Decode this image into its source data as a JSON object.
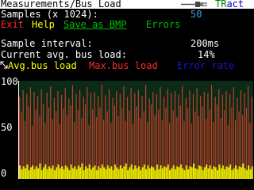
{
  "title_bar": {
    "title": "Measurements/Bus Load",
    "logo_text_a": "TR",
    "logo_text_b": "act"
  },
  "samples": {
    "label": "Samples (x 1024):",
    "value": "50"
  },
  "menu": {
    "exit": "Exit",
    "help": "Help",
    "save_as_bmp": "Save as BMP",
    "errors": "Errors"
  },
  "interval": {
    "label": "Sample interval:",
    "value": "200ms"
  },
  "current_load": {
    "label": "Current avg. bus load:",
    "value": "14%"
  },
  "legend": {
    "avg": "Avg.bus load",
    "max": "Max.bus load",
    "error": "Error rate"
  },
  "colors": {
    "avg": "#e6e600",
    "max": "#c84028",
    "error": "#1818c8",
    "plot_bg": "#0c2a18"
  },
  "chart_data": {
    "type": "bar",
    "ylim": [
      0,
      100
    ],
    "yticks": [
      "100",
      "50",
      "0"
    ],
    "series": [
      {
        "name": "Avg.bus load",
        "values": [
          14,
          10,
          13,
          11,
          15,
          9,
          12,
          14,
          10,
          13,
          11,
          16,
          9,
          12,
          15,
          10,
          13,
          11,
          14,
          9,
          12,
          15,
          11,
          13,
          10,
          14,
          12,
          9,
          15,
          11,
          13,
          10,
          14,
          12,
          16,
          9,
          13,
          11,
          15,
          10,
          12,
          14,
          9,
          13,
          11,
          15,
          12,
          10,
          14,
          11,
          13,
          9,
          15,
          12,
          10,
          14,
          11,
          13,
          16,
          9,
          12,
          15,
          10,
          14,
          11,
          13,
          9,
          12,
          15,
          10,
          14,
          11,
          13,
          12,
          9,
          15,
          10,
          14,
          11,
          13,
          12,
          15,
          9,
          11,
          14,
          10,
          13,
          12,
          15,
          11,
          9,
          14,
          10,
          13,
          12,
          16,
          11,
          10,
          14,
          13,
          9,
          12,
          15,
          11,
          14,
          10,
          13,
          12,
          9,
          15,
          11,
          14,
          10,
          13,
          12,
          15,
          9,
          11,
          14,
          10,
          13,
          12,
          16,
          11,
          9,
          14,
          10,
          13
        ]
      },
      {
        "name": "Max.bus load",
        "values": [
          85,
          70,
          92,
          60,
          88,
          75,
          95,
          55,
          90,
          72,
          86,
          65,
          93,
          78,
          58,
          89,
          74,
          96,
          62,
          84,
          70,
          91,
          57,
          87,
          73,
          94,
          66,
          83,
          76,
          97,
          59,
          88,
          71,
          92,
          63,
          85,
          77,
          95,
          56,
          89,
          72,
          90,
          64,
          86,
          74,
          98,
          61,
          87,
          70,
          93,
          58,
          84,
          76,
          91,
          65,
          88,
          73,
          96,
          60,
          85,
          71,
          94,
          57,
          89,
          75,
          92,
          63,
          86,
          70,
          97,
          59,
          83,
          77,
          90,
          66,
          88,
          72,
          95,
          61,
          85,
          74,
          93,
          58,
          89,
          71,
          91,
          64,
          87,
          76,
          96,
          60,
          84,
          73,
          92,
          57,
          88,
          70,
          94,
          65,
          86,
          75,
          90,
          62,
          89,
          72,
          97,
          59,
          85,
          77,
          93,
          63,
          87,
          71,
          91,
          56,
          88,
          74,
          95,
          61,
          84,
          70,
          92,
          66,
          89,
          73,
          96,
          58,
          85
        ]
      }
    ]
  }
}
